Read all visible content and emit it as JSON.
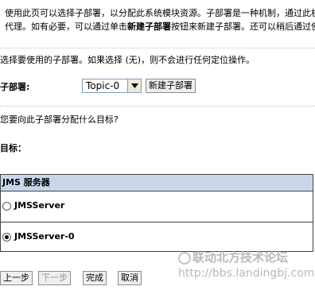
{
  "intro": {
    "line1": "使用此页可以选择子部署，以分配此系统模块资源。子部署是一种机制，通过此机制",
    "line2_a": "代理。如有必要，可以通过单击",
    "line2_bold": "新建子部署",
    "line2_b": "按钮来新建子部署。还可以稍后通过使"
  },
  "subdeployment": {
    "description": "选择要使用的子部署。如果选择 (无)，则不会进行任何定位操作。",
    "label": "子部署:",
    "selected": "Topic-0",
    "new_button": "新建子部署"
  },
  "targets": {
    "question": "您要向此子部署分配什么目标?",
    "label": "目标：",
    "table_header": "JMS 服务器",
    "rows": [
      {
        "label": "JMSServer",
        "checked": false
      },
      {
        "label": "JMSServer-0",
        "checked": true
      }
    ]
  },
  "buttons": {
    "back": "上一步",
    "next": "下一步",
    "finish": "完成",
    "cancel": "取消"
  },
  "watermark": {
    "text": "联动北方技术论坛",
    "url": "http://bbs.landingbj.com"
  }
}
